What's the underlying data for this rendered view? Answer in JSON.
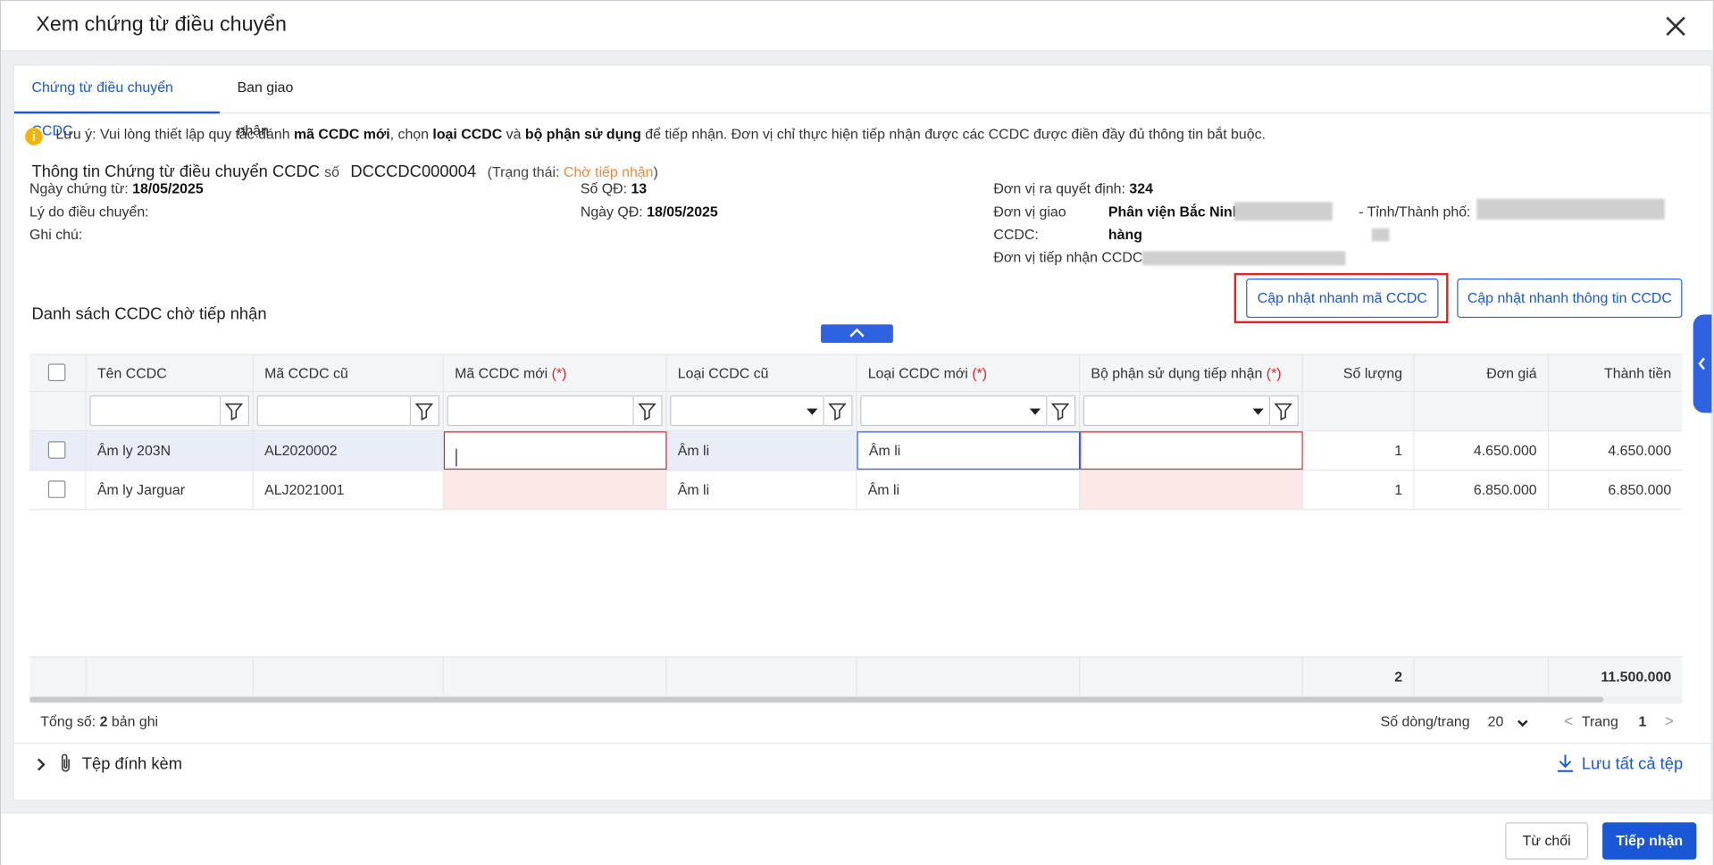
{
  "dialog": {
    "title": "Xem chứng từ điều chuyển"
  },
  "tabs": [
    {
      "label": "Chứng từ điều chuyển CCDC",
      "active": true
    },
    {
      "label": "Ban giao nhận",
      "active": false
    }
  ],
  "note": {
    "p1": "Lưu ý: Vui lòng thiết lập quy tắc đánh ",
    "b1": "mã CCDC mới",
    "p2": ", chọn ",
    "b2": "loại CCDC",
    "p3": " và ",
    "b3": "bộ phận sử dụng",
    "p4": " để tiếp nhận. Đơn vị chỉ thực hiện tiếp nhận được các CCDC được điền đầy đủ thông tin bắt buộc."
  },
  "info": {
    "title": "Thông tin Chứng từ điều chuyển CCDC",
    "so_label": "số",
    "so_value": "DCCCDC000004",
    "status_prefix": "(Trạng thái: ",
    "status": "Chờ tiếp nhận",
    "status_suffix": ")",
    "ngay_ct_label": "Ngày chứng từ:",
    "ngay_ct": "18/05/2025",
    "ly_do_label": "Lý do điều chuyển:",
    "ghi_chu_label": "Ghi chú:",
    "so_qd_label": "Số QĐ:",
    "so_qd": "13",
    "ngay_qd_label": "Ngày QĐ:",
    "ngay_qd": "18/05/2025",
    "dv_qd_label": "Đơn vị ra quyết định:",
    "dv_qd": "324",
    "dv_giao_label": "Đơn vị giao",
    "dv_giao": "Phân viện Bắc Ninh",
    "tinh_label": "- Tỉnh/Thành phố:",
    "ccdc_label": "CCDC:",
    "ccdc_value": "hàng",
    "dv_tn_label": "Đơn vị tiếp nhận CCDC:"
  },
  "list": {
    "title": "Danh sách CCDC chờ tiếp nhận",
    "btn_quick_code": "Cập nhật nhanh mã CCDC",
    "btn_quick_info": "Cập nhật nhanh thông tin CCDC"
  },
  "table": {
    "columns": {
      "ten": "Tên CCDC",
      "ma_cu": "Mã CCDC cũ",
      "ma_moi": "Mã CCDC mới",
      "loai_cu": "Loại CCDC cũ",
      "loai_moi": "Loại CCDC mới",
      "bo_phan": "Bộ phận sử dụng tiếp nhận",
      "so_luong": "Số lượng",
      "don_gia": "Đơn giá",
      "thanh_tien": "Thành tiền",
      "req": "(*)"
    },
    "rows": [
      {
        "ten": "Âm ly 203N",
        "ma_cu": "AL2020002",
        "ma_moi": "",
        "loai_cu": "Âm li",
        "loai_moi": "Âm li",
        "bo_phan": "",
        "so_luong": "1",
        "don_gia": "4.650.000",
        "thanh_tien": "4.650.000"
      },
      {
        "ten": "Âm ly Jarguar",
        "ma_cu": "ALJ2021001",
        "ma_moi": "",
        "loai_cu": "Âm li",
        "loai_moi": "Âm li",
        "bo_phan": "",
        "so_luong": "1",
        "don_gia": "6.850.000",
        "thanh_tien": "6.850.000"
      }
    ],
    "totals": {
      "so_luong": "2",
      "thanh_tien": "11.500.000"
    }
  },
  "pager": {
    "total_label": "Tổng số: ",
    "total_value": "2",
    "total_unit": " bản ghi",
    "rows_per_page_label": "Số dòng/trang",
    "rows_per_page": "20",
    "page_label": "Trang",
    "page": "1"
  },
  "attachments": {
    "label": "Tệp đính kèm",
    "save_all": "Lưu tất cả tệp"
  },
  "footer": {
    "reject": "Từ chối",
    "accept": "Tiếp nhận"
  },
  "colors": {
    "accent": "#1a57d6",
    "status": "#f0883e",
    "required": "#e02424",
    "invalid_bg": "#fde8e8"
  }
}
